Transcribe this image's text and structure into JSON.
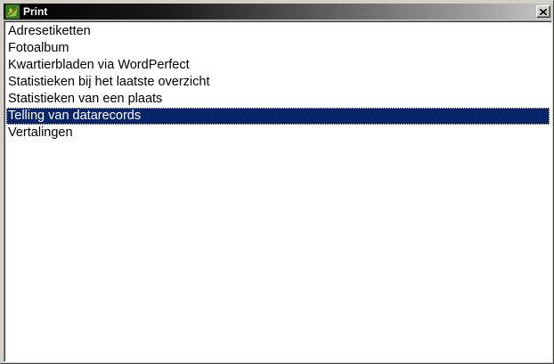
{
  "window": {
    "title": "Print",
    "icon": "app-leaf-icon",
    "close_icon": "close-icon"
  },
  "list": {
    "items": [
      {
        "label": "Adresetiketten",
        "selected": false
      },
      {
        "label": "Fotoalbum",
        "selected": false
      },
      {
        "label": "Kwartierbladen via WordPerfect",
        "selected": false
      },
      {
        "label": "Statistieken bij het laatste overzicht",
        "selected": false
      },
      {
        "label": "Statistieken van een plaats",
        "selected": false
      },
      {
        "label": "Telling van datarecords",
        "selected": true
      },
      {
        "label": "Vertalingen",
        "selected": false
      }
    ]
  },
  "colors": {
    "selection_background": "#0a246a",
    "selection_text": "#ffffff",
    "window_face": "#d4d0c8"
  }
}
